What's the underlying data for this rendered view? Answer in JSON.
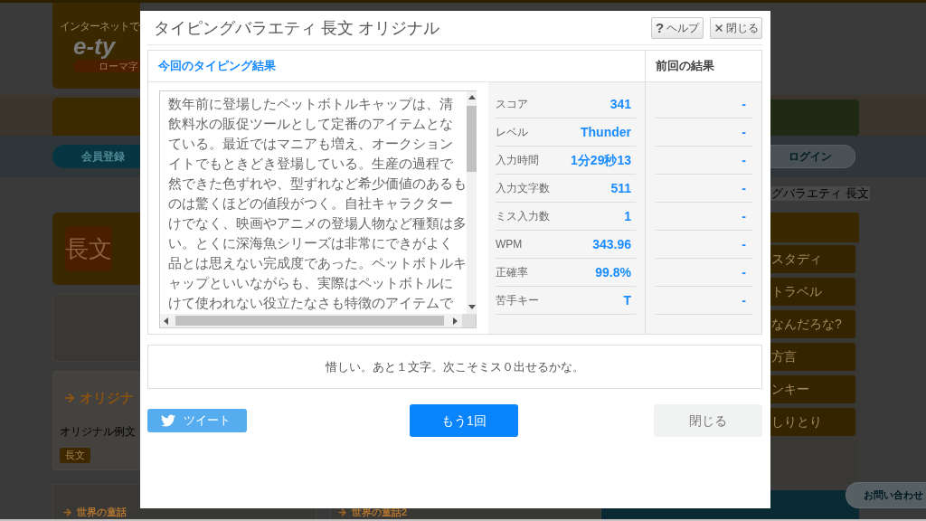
{
  "background": {
    "logo": {
      "tagline": "インターネットで",
      "wordmark": "e-ty",
      "badge": "ローマ字"
    },
    "register_button": "会員登録",
    "login_button": "ログイン",
    "category_tile": "長文",
    "category_card": {
      "title": "オリジナ",
      "description": "オリジナル例文",
      "tag": "長文"
    },
    "story_cards": [
      {
        "title": "世界の童話"
      },
      {
        "title": "世界の童話2"
      }
    ],
    "breadcrumb": "グバラエティ 長文",
    "menu_items": [
      {
        "label": "スタディ"
      },
      {
        "label": "トラベル"
      },
      {
        "label": "なんだろな?"
      },
      {
        "label": "方言"
      },
      {
        "label": "ンキー"
      },
      {
        "label": "しりとり"
      }
    ],
    "contact_button": "お問い合わせ"
  },
  "dialog": {
    "title": "タイピングバラエティ 長文 オリジナル",
    "header_buttons": [
      {
        "kind": "help",
        "symbol": "?",
        "label": "ヘルプ"
      },
      {
        "kind": "close",
        "label": "閉じる"
      }
    ],
    "current_heading": "今回のタイピング結果",
    "previous_heading": "前回の結果",
    "passage_lines": [
      "数年前に登場したペットボトルキャップは、清",
      "飲料水の販促ツールとして定番のアイテムとな",
      "ている。最近ではマニアも増え、オークション",
      "イトでもときどき登場している。生産の過程で",
      "然できた色ずれや、型ずれなど希少価値のあるも",
      "のは驚くほどの値段がつく。自社キャラクター",
      "けでなく、映画やアニメの登場人物など種類は多",
      "い。とくに深海魚シリーズは非常にできがよく",
      "品とは思えない完成度であった。ペットボトルキ",
      "ャップといいながらも、実際はペットボトルに",
      "けて使われない役立たなさも特徴のアイテムで"
    ],
    "stats": [
      {
        "label": "スコア",
        "value": "341",
        "previous": "-"
      },
      {
        "label": "レベル",
        "value": "Thunder",
        "previous": "-"
      },
      {
        "label": "入力時間",
        "value": "1分29秒13",
        "previous": "-"
      },
      {
        "label": "入力文字数",
        "value": "511",
        "previous": "-"
      },
      {
        "label": "ミス入力数",
        "value": "1",
        "previous": "-"
      },
      {
        "label": "WPM",
        "value": "343.96",
        "previous": "-"
      },
      {
        "label": "正確率",
        "value": "99.8%",
        "previous": "-"
      },
      {
        "label": "苦手キー",
        "value": "T",
        "previous": "-"
      }
    ],
    "message": "惜しい。あと１文字。次こそミス０出せるかな。",
    "buttons": [
      {
        "kind": "tweet",
        "label": "ツイート"
      },
      {
        "kind": "retry",
        "label": "もう1回"
      },
      {
        "kind": "close",
        "label": "閉じる"
      }
    ]
  }
}
